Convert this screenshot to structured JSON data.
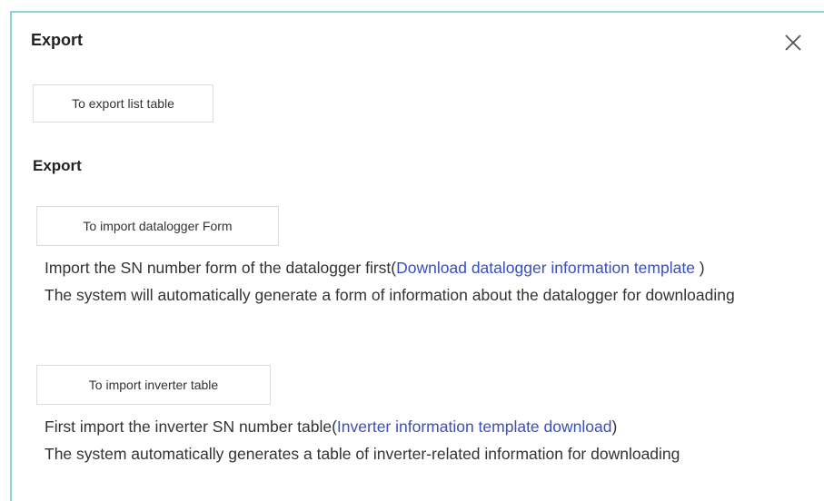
{
  "dialog": {
    "title": "Export",
    "close_icon": "close-icon",
    "export_button_label": "To export list table",
    "section_title": "Export",
    "datalogger": {
      "button_label": "To import datalogger Form",
      "line1_prefix": "Import the SN number form of the datalogger first(",
      "line1_link": "Download datalogger information template",
      "line1_suffix": " )",
      "line2": "The system will automatically generate a form of information about the datalogger for downloading"
    },
    "inverter": {
      "button_label": "To import inverter table",
      "line1_prefix": "First import the inverter SN number table(",
      "line1_link": "Inverter information template download",
      "line1_suffix": ")",
      "line2": "The system automatically generates a table of inverter-related information for downloading"
    }
  },
  "colors": {
    "border": "#8fd0dd",
    "link": "#3a4fb8",
    "button_border": "#dcdcdc"
  }
}
